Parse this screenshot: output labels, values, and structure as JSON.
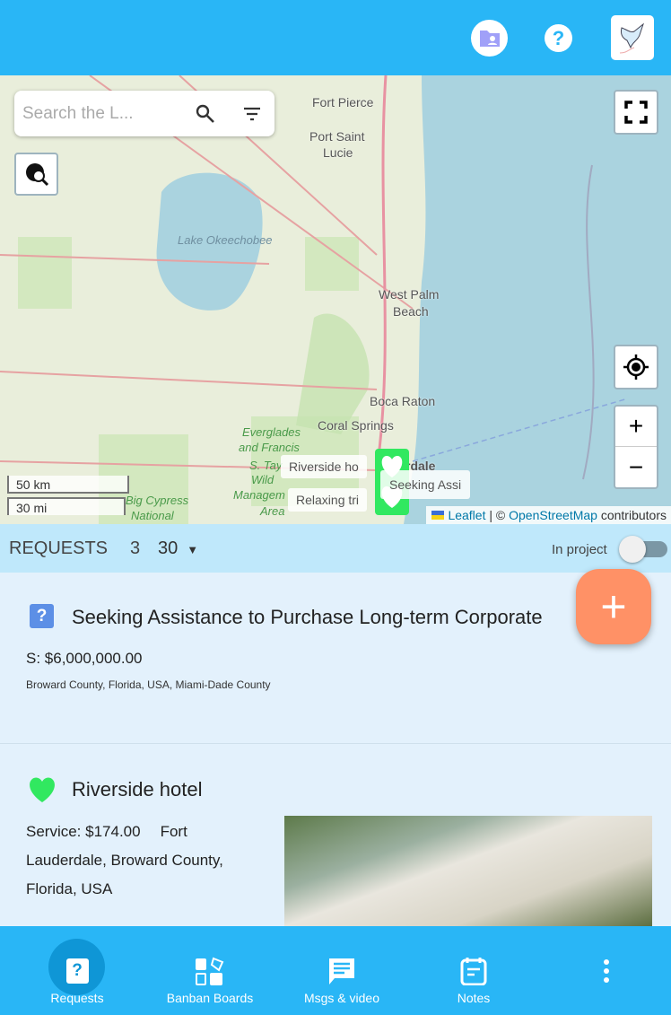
{
  "header": {
    "folder_icon": "folder-account-icon",
    "help_icon": "help-circle-icon",
    "logo": "dove-logo"
  },
  "map": {
    "search_placeholder": "Search the L...",
    "labels": {
      "fort_pierce": "Fort Pierce",
      "port_saint": "Port Saint",
      "lucie": "Lucie",
      "okeechobee": "Lake Okeechobee",
      "west_palm": "West Palm",
      "beach": "Beach",
      "boca": "Boca Raton",
      "coral": "Coral Springs",
      "everglades": "Everglades",
      "and_francis": "and Francis",
      "s_tay": "S. Tay",
      "wild": "Wild",
      "manager": "Managem",
      "area": "Area",
      "big_cypress": "Big Cypress",
      "national": "National",
      "dale": "rdale"
    },
    "scale_km": "50 km",
    "scale_mi": "30 mi",
    "tooltips": [
      "Riverside ho",
      "Relaxing tri",
      "Seeking Assi"
    ],
    "attribution": {
      "leaflet": "Leaflet",
      "sep": " | © ",
      "osm": "OpenStreetMap",
      "contributors": " contributors"
    },
    "zoom_in": "+",
    "zoom_out": "−"
  },
  "requests": {
    "title": "REQUESTS",
    "count": "3",
    "page_size": "30",
    "in_project_label": "In project",
    "in_project_on": false
  },
  "cards": [
    {
      "icon": "help-box-icon",
      "title": "Seeking Assistance to Purchase Long-term Corporate",
      "price": "S: $6,000,000.00",
      "location": "Broward County, Florida, USA, Miami-Dade County"
    },
    {
      "icon": "heart-icon",
      "title": "Riverside hotel",
      "price": "Service: $174.00",
      "location": "Fort Lauderdale, Broward County, Florida, USA"
    }
  ],
  "fab": "+",
  "bottom_nav": [
    {
      "label": "Requests",
      "icon": "help-box-icon",
      "active": true
    },
    {
      "label": "Banban Boards",
      "icon": "boards-icon"
    },
    {
      "label": "Msgs & video",
      "icon": "message-icon"
    },
    {
      "label": "Notes",
      "icon": "notes-icon"
    },
    {
      "label": "",
      "icon": "more-vertical-icon"
    }
  ],
  "colors": {
    "primary": "#29b6f6",
    "accent": "#ff9166",
    "marker": "#31e860"
  }
}
